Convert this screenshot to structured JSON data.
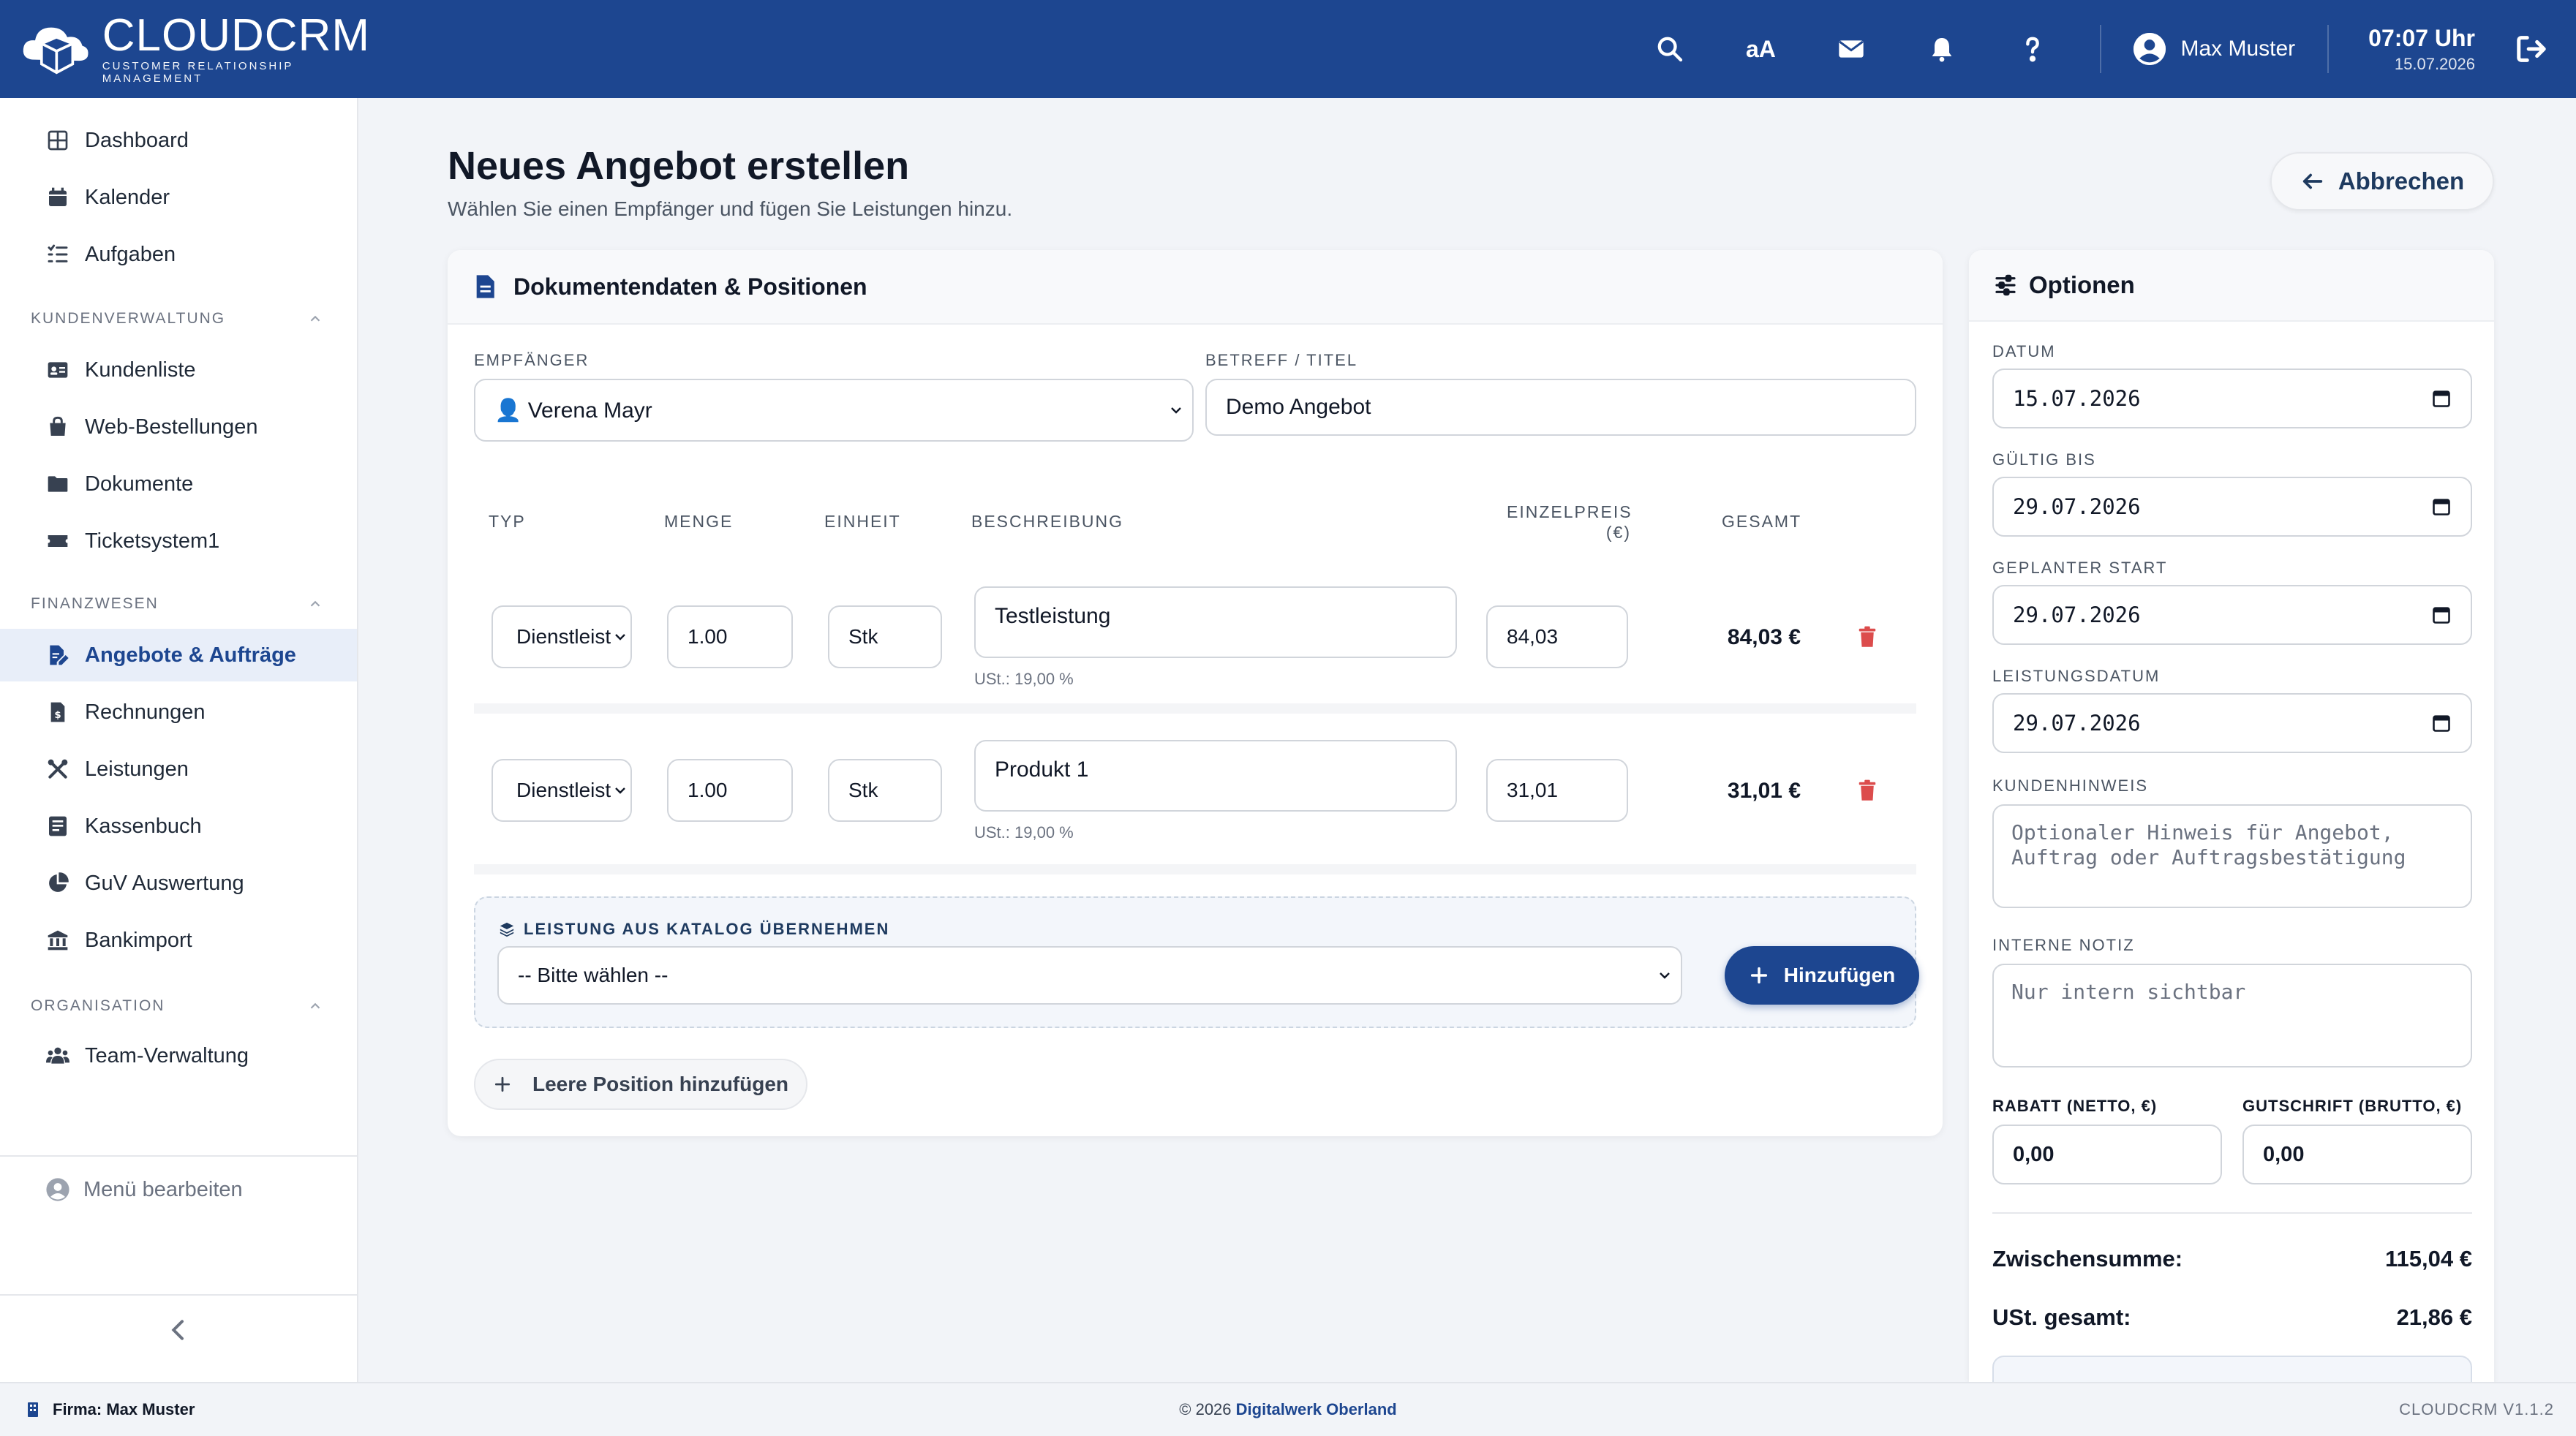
{
  "app": {
    "name": "CLOUDCRM",
    "tagline": "CUSTOMER RELATIONSHIP MANAGEMENT"
  },
  "header": {
    "font_toggle": "aA",
    "user_name": "Max Muster",
    "time": "07:07 Uhr",
    "date": "15.07.2026"
  },
  "sidebar": {
    "items_top": [
      {
        "label": "Dashboard",
        "icon": "grid-icon"
      },
      {
        "label": "Kalender",
        "icon": "calendar-icon"
      },
      {
        "label": "Aufgaben",
        "icon": "list-icon"
      }
    ],
    "section_customers": "KUNDENVERWALTUNG",
    "items_customers": [
      {
        "label": "Kundenliste",
        "icon": "id-card-icon"
      },
      {
        "label": "Web-Bestellungen",
        "icon": "shopping-bag-icon"
      },
      {
        "label": "Dokumente",
        "icon": "folder-icon"
      },
      {
        "label": "Ticketsystem1",
        "icon": "ticket-icon"
      }
    ],
    "section_finance": "FINANZWESEN",
    "items_finance": [
      {
        "label": "Angebote & Aufträge",
        "icon": "edit-document-icon",
        "active": true
      },
      {
        "label": "Rechnungen",
        "icon": "invoice-icon"
      },
      {
        "label": "Leistungen",
        "icon": "tools-icon"
      },
      {
        "label": "Kassenbuch",
        "icon": "cashbook-icon"
      },
      {
        "label": "GuV Auswertung",
        "icon": "pie-chart-icon"
      },
      {
        "label": "Bankimport",
        "icon": "bank-icon"
      }
    ],
    "section_org": "ORGANISATION",
    "items_org": [
      {
        "label": "Team-Verwaltung",
        "icon": "users-icon"
      }
    ],
    "menu_edit": "Menü bearbeiten"
  },
  "page": {
    "title": "Neues Angebot erstellen",
    "subtitle": "Wählen Sie einen Empfänger und fügen Sie Leistungen hinzu.",
    "cancel_label": "Abbrechen"
  },
  "document_card": {
    "title": "Dokumentendaten & Positionen",
    "recipient_label": "EMPFÄNGER",
    "recipient_value": "👤 Verena Mayr",
    "subject_label": "BETREFF / TITEL",
    "subject_value": "Demo Angebot",
    "columns": {
      "type": "TYP",
      "qty": "MENGE",
      "unit": "EINHEIT",
      "desc": "BESCHREIBUNG",
      "price_1": "EINZELPREIS",
      "price_2": "(€)",
      "total": "GESAMT"
    },
    "rows": [
      {
        "type": "Dienstleist",
        "qty": "1.00",
        "unit": "Stk",
        "desc": "Testleistung",
        "tax": "USt.: 19,00 %",
        "price": "84,03",
        "total": "84,03 €"
      },
      {
        "type": "Dienstleist",
        "qty": "1.00",
        "unit": "Stk",
        "desc": "Produkt 1",
        "tax": "USt.: 19,00 %",
        "price": "31,01",
        "total": "31,01 €"
      }
    ],
    "catalog_label": "LEISTUNG AUS KATALOG ÜBERNEHMEN",
    "catalog_select": "-- Bitte wählen --",
    "add_label": "Hinzufügen",
    "empty_position_label": "Leere Position hinzufügen"
  },
  "options": {
    "title": "Optionen",
    "date_label": "DATUM",
    "date_value": "15.07.2026",
    "valid_label": "GÜLTIG BIS",
    "valid_value": "29.07.2026",
    "start_label": "GEPLANTER START",
    "start_value": "29.07.2026",
    "service_label": "LEISTUNGSDATUM",
    "service_value": "29.07.2026",
    "customer_note_label": "KUNDENHINWEIS",
    "customer_note_placeholder": "Optionaler Hinweis für Angebot, Auftrag oder Auftragsbestätigung",
    "internal_note_label": "INTERNE NOTIZ",
    "internal_note_placeholder": "Nur intern sichtbar",
    "discount_label": "RABATT (NETTO, €)",
    "discount_value": "0,00",
    "credit_label": "GUTSCHRIFT (BRUTTO, €)",
    "credit_value": "0,00",
    "subtotal_label": "Zwischensumme:",
    "subtotal_value": "115,04 €",
    "vat_label": "USt. gesamt:",
    "vat_value": "21,86 €"
  },
  "footer": {
    "company": "Firma: Max Muster",
    "copyright": "© 2026",
    "author": "Digitalwerk Oberland",
    "version": "CLOUDCRM V1.1.2"
  },
  "colors": {
    "brand": "#1d4690",
    "danger": "#dc4c4c",
    "active_bg": "#e8eef9"
  }
}
